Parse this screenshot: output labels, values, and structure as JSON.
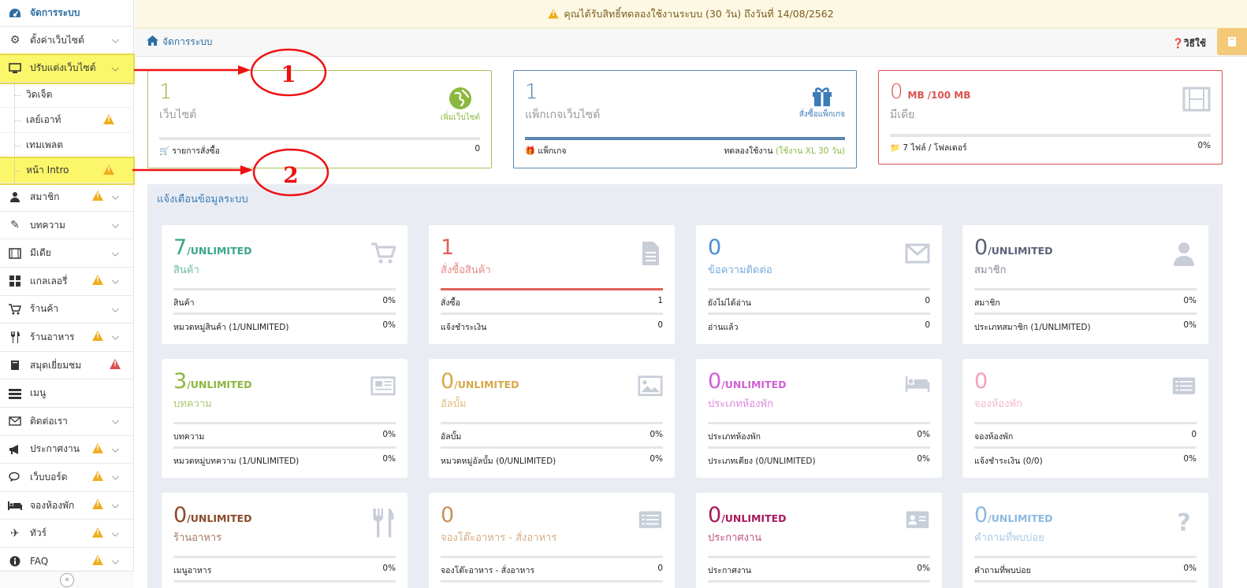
{
  "notice": {
    "text": "คุณได้รับสิทธิ์ทดลองใช้งานระบบ (30 วัน) ถึงวันที่ 14/08/2562"
  },
  "breadcrumb": {
    "label": "จัดการระบบ"
  },
  "help": {
    "label": "วิธีใช้"
  },
  "sidebar": {
    "header": "จัดการระบบ",
    "items": [
      {
        "label": "ตั้งค่าเว็บไซต์",
        "icon": "gear-icon"
      },
      {
        "label": "ปรับแต่งเว็บไซต์",
        "icon": "monitor-icon"
      },
      {
        "label": "สมาชิก",
        "icon": "user-icon"
      },
      {
        "label": "บทความ",
        "icon": "edit-icon"
      },
      {
        "label": "มีเดีย",
        "icon": "film-icon"
      },
      {
        "label": "แกลเลอรี่",
        "icon": "grid-icon"
      },
      {
        "label": "ร้านค้า",
        "icon": "cart-icon"
      },
      {
        "label": "ร้านอาหาร",
        "icon": "utensils-icon"
      },
      {
        "label": "สมุดเยี่ยมชม",
        "icon": "book-icon"
      },
      {
        "label": "เมนู",
        "icon": "menu-icon"
      },
      {
        "label": "ติดต่อเรา",
        "icon": "envelope-icon"
      },
      {
        "label": "ประกาศงาน",
        "icon": "megaphone-icon"
      },
      {
        "label": "เว็บบอร์ด",
        "icon": "comments-icon"
      },
      {
        "label": "จองห้องพัก",
        "icon": "bed-icon"
      },
      {
        "label": "ทัวร์",
        "icon": "plane-icon"
      },
      {
        "label": "FAQ",
        "icon": "info-icon"
      }
    ],
    "subitems": [
      {
        "label": "วิดเจ็ต"
      },
      {
        "label": "เลย์เอาท์"
      },
      {
        "label": "เทมเพลต"
      },
      {
        "label": "หน้า Intro"
      }
    ]
  },
  "summary": {
    "website": {
      "num": "1",
      "caption": "เว็บไซต์",
      "action": "เพิ่มเว็บไซต์",
      "foot_label": "รายการสั่งซื้อ",
      "foot_value": "0"
    },
    "package": {
      "num": "1",
      "caption": "แพ็กเกจเว็บไซต์",
      "action": "สั่งซื้อแพ็กเกจ",
      "foot_label": "แพ็กเกจ",
      "foot_value": "ทดลองใช้งาน",
      "foot_note": "(ใช้งาน XL 30 วัน)"
    },
    "media": {
      "num": "0",
      "unit": "MB",
      "limit": "/100 MB",
      "caption": "มีเดีย",
      "foot_label": "7 ไฟล์ / โฟลเดอร์",
      "foot_value": "0%"
    }
  },
  "panel": {
    "title": "แจ้งเตือนข้อมูลระบบ"
  },
  "cards": [
    {
      "num": "7",
      "suffix": "/UNLIMITED",
      "title": "สินค้า",
      "color": "#3aa58a",
      "icon": "cart-icon",
      "r1l": "สินค้า",
      "r1v": "0%",
      "r2l": "หมวดหมู่สินค้า (1/UNLIMITED)",
      "r2v": "0%"
    },
    {
      "num": "1",
      "suffix": "",
      "title": "สั่งซื้อสินค้า",
      "color": "#e0605a",
      "icon": "document-icon",
      "r1l": "สั่งซื้อ",
      "r1v": "1",
      "r2l": "แจ้งชำระเงิน",
      "r2v": "0"
    },
    {
      "num": "0",
      "suffix": "",
      "title": "ข้อความติดต่อ",
      "color": "#4a8fd0",
      "icon": "envelope-icon",
      "r1l": "ยังไม่ได้อ่าน",
      "r1v": "0",
      "r2l": "อ่านแล้ว",
      "r2v": "0"
    },
    {
      "num": "0",
      "suffix": "/UNLIMITED",
      "title": "สมาชิก",
      "color": "#5c6178",
      "icon": "user-icon",
      "r1l": "สมาชิก",
      "r1v": "0%",
      "r2l": "ประเภทสมาชิก (1/UNLIMITED)",
      "r2v": "0%"
    },
    {
      "num": "3",
      "suffix": "/UNLIMITED",
      "title": "บทความ",
      "color": "#8cb83f",
      "icon": "newspaper-icon",
      "r1l": "บทความ",
      "r1v": "0%",
      "r2l": "หมวดหมู่บทความ (1/UNLIMITED)",
      "r2v": "0%"
    },
    {
      "num": "0",
      "suffix": "/UNLIMITED",
      "title": "อัลบั้ม",
      "color": "#d6a84a",
      "icon": "image-icon",
      "r1l": "อัลบั้ม",
      "r1v": "0%",
      "r2l": "หมวดหมู่อัลบั้ม (0/UNLIMITED)",
      "r2v": "0%"
    },
    {
      "num": "0",
      "suffix": "/UNLIMITED",
      "title": "ประเภทห้องพัก",
      "color": "#d25fd6",
      "icon": "bed-icon",
      "r1l": "ประเภทห้องพัก",
      "r1v": "0%",
      "r2l": "ประเภทเตียง (0/UNLIMITED)",
      "r2v": "0%"
    },
    {
      "num": "0",
      "suffix": "",
      "title": "จองห้องพัก",
      "color": "#f1a1b8",
      "icon": "list-icon",
      "r1l": "จองห้องพัก",
      "r1v": "0",
      "r2l": "แจ้งชำระเงิน (0/0)",
      "r2v": "0%"
    },
    {
      "num": "0",
      "suffix": "/UNLIMITED",
      "title": "ร้านอาหาร",
      "color": "#8a4a2a",
      "icon": "utensils-icon",
      "r1l": "เมนูอาหาร",
      "r1v": "0%",
      "r2l": "",
      "r2v": ""
    },
    {
      "num": "0",
      "suffix": "",
      "title": "จองโต๊ะอาหาร - สั่งอาหาร",
      "color": "#c8925a",
      "icon": "list-icon",
      "r1l": "จองโต๊ะอาหาร - สั่งอาหาร",
      "r1v": "0",
      "r2l": "",
      "r2v": ""
    },
    {
      "num": "0",
      "suffix": "/UNLIMITED",
      "title": "ประกาศงาน",
      "color": "#a8185a",
      "icon": "idcard-icon",
      "r1l": "ประกาศงาน",
      "r1v": "0%",
      "r2l": "",
      "r2v": ""
    },
    {
      "num": "0",
      "suffix": "/UNLIMITED",
      "title": "คำถามที่พบบ่อย",
      "color": "#8db8e0",
      "icon": "question-icon",
      "r1l": "คำถามที่พบบ่อย",
      "r1v": "0%",
      "r2l": "",
      "r2v": ""
    }
  ],
  "annotations": {
    "one": "1",
    "two": "2"
  },
  "colors": {
    "accent": "#2d6ea3",
    "warning": "#f0ad1e",
    "highlight": "#fbf66a",
    "annotation": "#e11"
  }
}
